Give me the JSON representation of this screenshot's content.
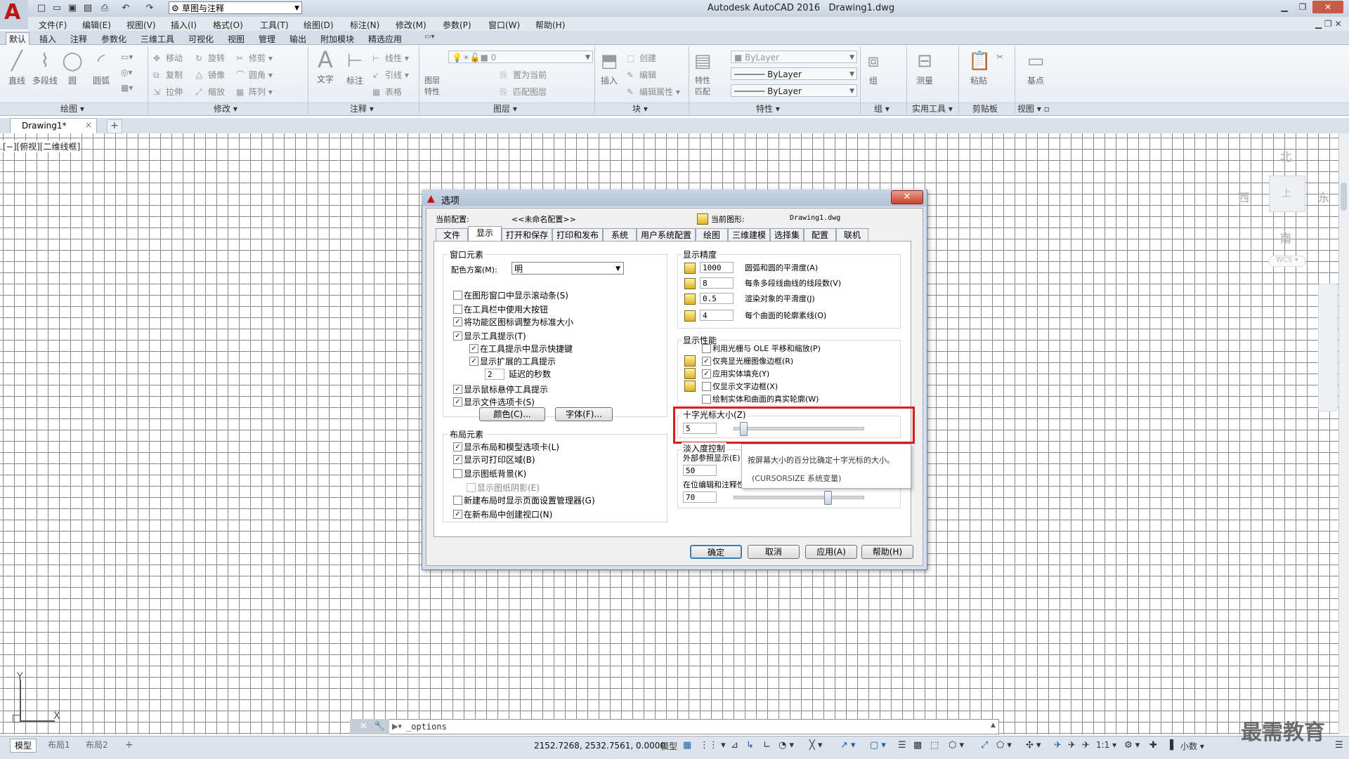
{
  "app": {
    "title": "Autodesk AutoCAD 2016",
    "document": "Drawing1.dwg",
    "logo": "A",
    "workspace": "草图与注释"
  },
  "menubar": [
    "文件(F)",
    "编辑(E)",
    "视图(V)",
    "插入(I)",
    "格式(O)",
    "工具(T)",
    "绘图(D)",
    "标注(N)",
    "修改(M)",
    "参数(P)",
    "窗口(W)",
    "帮助(H)"
  ],
  "ribbon_tabs": [
    "默认",
    "插入",
    "注释",
    "参数化",
    "三维工具",
    "可视化",
    "视图",
    "管理",
    "输出",
    "附加模块",
    "精选应用"
  ],
  "ribbon": {
    "draw": {
      "title": "绘图",
      "line": "直线",
      "polyline": "多段线",
      "circle": "圆",
      "arc": "圆弧"
    },
    "modify": {
      "title": "修改",
      "move": "移动",
      "rotate": "旋转",
      "trim": "修剪",
      "copy": "复制",
      "mirror": "镜像",
      "fillet": "圆角",
      "stretch": "拉伸",
      "scale": "缩放",
      "array": "阵列"
    },
    "annotation": {
      "title": "注释",
      "text": "文字",
      "dimension": "标注",
      "linear": "线性",
      "leader": "引线",
      "table": "表格"
    },
    "layers": {
      "title": "图层",
      "layer_props": "图层特性",
      "layer_value": "0",
      "set_current": "置为当前",
      "match_layer": "匹配图层"
    },
    "block": {
      "title": "块",
      "insert": "插入",
      "create": "创建",
      "edit": "编辑",
      "edit_attr": "编辑属性"
    },
    "properties": {
      "title": "特性",
      "match": "特性匹配",
      "color": "ByLayer",
      "linetype": "ByLayer",
      "lineweight": "ByLayer"
    },
    "group": {
      "title": "组",
      "group": "组"
    },
    "utilities": {
      "title": "实用工具",
      "measure": "测量"
    },
    "clipboard": {
      "title": "剪贴板",
      "paste": "粘贴"
    },
    "view": {
      "title": "视图",
      "base": "基点"
    }
  },
  "doc_tab": {
    "label": "Drawing1*",
    "close": "×",
    "new": "+"
  },
  "viewport_label": "[−][俯视][二维线框]",
  "viewcube": {
    "north": "北",
    "south": "南",
    "east": "东",
    "west": "西",
    "center": "上",
    "wcs": "WCS"
  },
  "ucs": {
    "x": "X",
    "y": "Y"
  },
  "command_line": {
    "text": "_options"
  },
  "statusbar": {
    "layout_tabs": [
      "模型",
      "布局1",
      "布局2"
    ],
    "add": "+",
    "coords": "2152.7268, 2532.7561, 0.0000",
    "model": "模型",
    "scale": "1:1",
    "units": "小数"
  },
  "watermark": "最需教育",
  "dialog": {
    "title": "选项",
    "close": "✕",
    "current_profile_label": "当前配置:",
    "current_profile": "<<未命名配置>>",
    "current_drawing_label": "当前图形:",
    "current_drawing": "Drawing1.dwg",
    "tabs": [
      "文件",
      "显示",
      "打开和保存",
      "打印和发布",
      "系统",
      "用户系统配置",
      "绘图",
      "三维建模",
      "选择集",
      "配置",
      "联机"
    ],
    "window_elements": {
      "title": "窗口元素",
      "color_scheme_label": "配色方案(M):",
      "color_scheme": "明",
      "checks": [
        {
          "label": "在图形窗口中显示滚动条(S)",
          "checked": false
        },
        {
          "label": "在工具栏中使用大按钮",
          "checked": false
        },
        {
          "label": "将功能区图标调整为标准大小",
          "checked": true
        },
        {
          "label": "显示工具提示(T)",
          "checked": true
        },
        {
          "label": "在工具提示中显示快捷键",
          "checked": true
        },
        {
          "label": "显示扩展的工具提示",
          "checked": true
        },
        {
          "label": "显示鼠标悬停工具提示",
          "checked": true
        },
        {
          "label": "显示文件选项卡(S)",
          "checked": true
        }
      ],
      "delay_value": "2",
      "delay_label": "延迟的秒数",
      "colors_btn": "颜色(C)...",
      "fonts_btn": "字体(F)..."
    },
    "layout_elements": {
      "title": "布局元素",
      "checks": [
        {
          "label": "显示布局和模型选项卡(L)",
          "checked": true
        },
        {
          "label": "显示可打印区域(B)",
          "checked": true
        },
        {
          "label": "显示图纸背景(K)",
          "checked": false
        },
        {
          "label": "显示图纸阴影(E)",
          "checked": false
        },
        {
          "label": "新建布局时显示页面设置管理器(G)",
          "checked": false
        },
        {
          "label": "在新布局中创建视口(N)",
          "checked": true
        }
      ]
    },
    "display_resolution": {
      "title": "显示精度",
      "items": [
        {
          "value": "1000",
          "label": "圆弧和圆的平滑度(A)"
        },
        {
          "value": "8",
          "label": "每条多段线曲线的线段数(V)"
        },
        {
          "value": "0.5",
          "label": "渲染对象的平滑度(J)"
        },
        {
          "value": "4",
          "label": "每个曲面的轮廓素线(O)"
        }
      ]
    },
    "display_performance": {
      "title": "显示性能",
      "checks": [
        {
          "label": "利用光栅与 OLE 平移和缩放(P)",
          "checked": false
        },
        {
          "label": "仅亮显光栅图像边框(R)",
          "checked": true
        },
        {
          "label": "应用实体填充(Y)",
          "checked": true
        },
        {
          "label": "仅显示文字边框(X)",
          "checked": false
        },
        {
          "label": "绘制实体和曲面的真实轮廓(W)",
          "checked": false
        }
      ]
    },
    "crosshair": {
      "title": "十字光标大小(Z)",
      "value": "5",
      "fraction": 0.05
    },
    "fade_control": {
      "title": "淡入度控制",
      "xref_label": "外部参照显示(E)",
      "xref_value": "50",
      "inplace_label": "在位编辑和注释性表达(I)",
      "inplace_value": "70",
      "inplace_fraction": 0.7
    },
    "tooltip": {
      "line1": "按屏幕大小的百分比确定十字光标的大小。",
      "line2": "(CURSORSIZE 系统变量)"
    },
    "buttons": {
      "ok": "确定",
      "cancel": "取消",
      "apply": "应用(A)",
      "help": "帮助(H)"
    }
  }
}
